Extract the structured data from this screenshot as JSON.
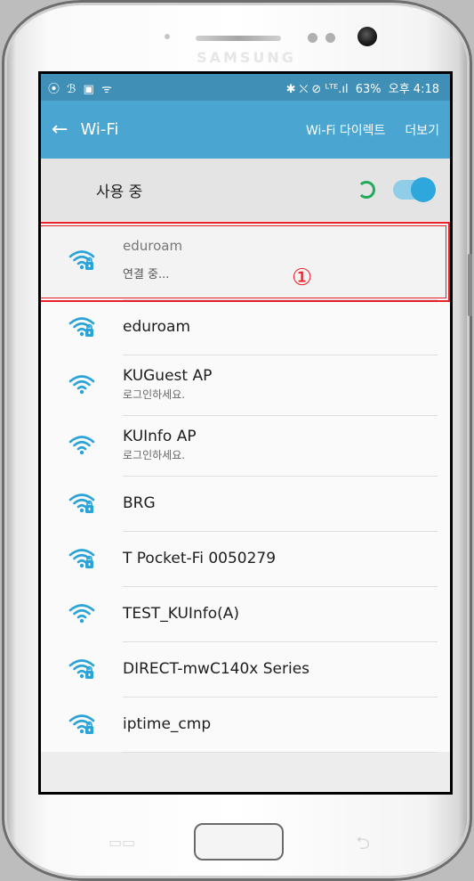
{
  "device": {
    "brand": "SAMSUNG"
  },
  "statusbar": {
    "left_icons": [
      "⦿",
      "ℬ",
      "▣",
      "ᯤ"
    ],
    "right_icons": "✱ ⛌ ⊘ ᴸᵀᴱ.ıl",
    "battery": "63%",
    "time": "오후 4:18"
  },
  "appbar": {
    "title": "Wi-Fi",
    "action1": "Wi-Fi 다이렉트",
    "action2": "더보기"
  },
  "toggle": {
    "label": "사용 중",
    "state": "on"
  },
  "annotation": {
    "marker": "①",
    "color": "#e8202a"
  },
  "networks": [
    {
      "name": "eduroam",
      "sub": "연결 중...",
      "secured": true,
      "connecting": true
    },
    {
      "name": "eduroam",
      "sub": "",
      "secured": true
    },
    {
      "name": "KUGuest AP",
      "sub": "로그인하세요.",
      "secured": false
    },
    {
      "name": "KUInfo AP",
      "sub": "로그인하세요.",
      "secured": false
    },
    {
      "name": "BRG",
      "sub": "",
      "secured": true
    },
    {
      "name": "T Pocket-Fi 0050279",
      "sub": "",
      "secured": true
    },
    {
      "name": "TEST_KUInfo(A)",
      "sub": "",
      "secured": false
    },
    {
      "name": "DIRECT-mwC140x Series",
      "sub": "",
      "secured": true
    },
    {
      "name": "iptime_cmp",
      "sub": "",
      "secured": true
    }
  ],
  "colors": {
    "statusbar": "#3f8fb7",
    "appbar": "#4aa5d0",
    "accent": "#2ea7dc",
    "wifi_icon": "#2aa3d8"
  }
}
